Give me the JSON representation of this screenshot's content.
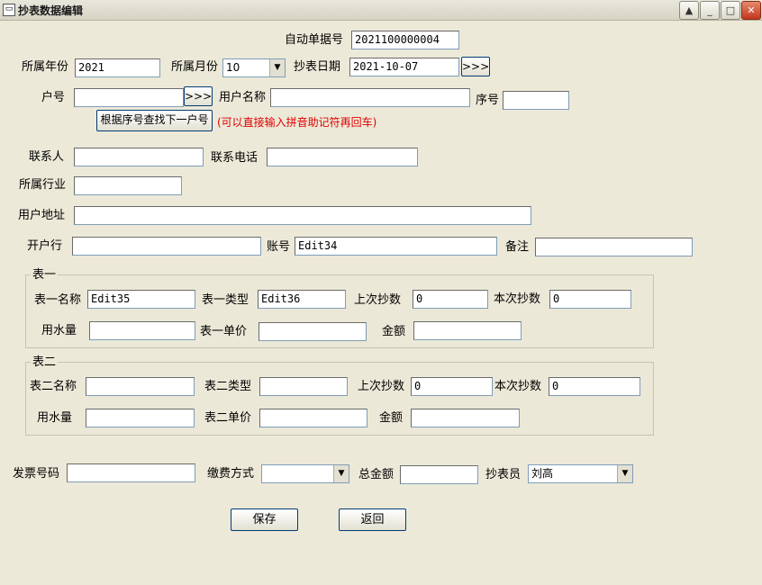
{
  "window": {
    "title": "抄表数据编辑",
    "min": "_",
    "max": "□",
    "close": "✕",
    "menu": "▲"
  },
  "form": {
    "bill_no": {
      "label": "自动单据号",
      "value": "2021100000004"
    },
    "year": {
      "label": "所属年份",
      "value": "2021"
    },
    "month": {
      "label": "所属月份",
      "value": "10"
    },
    "read_date": {
      "label": "抄表日期",
      "value": "2021-10-07",
      "button": ">>>"
    },
    "account_no": {
      "label": "户号",
      "value": "",
      "button": ">>>"
    },
    "user_name": {
      "label": "用户名称",
      "value": ""
    },
    "seq_no": {
      "label": "序号",
      "value": ""
    },
    "find_next": {
      "label": "根据序号查找下一户号"
    },
    "hint": "(可以直接输入拼音助记符再回车)",
    "contact": {
      "label": "联系人",
      "value": ""
    },
    "phone": {
      "label": "联系电话",
      "value": ""
    },
    "industry": {
      "label": "所属行业",
      "value": ""
    },
    "address": {
      "label": "用户地址",
      "value": ""
    },
    "bank": {
      "label": "开户行",
      "value": ""
    },
    "bank_account": {
      "label": "账号",
      "value": "Edit34"
    },
    "remark": {
      "label": "备注",
      "value": ""
    }
  },
  "meter1": {
    "title": "表一",
    "name": {
      "label": "表一名称",
      "value": "Edit35"
    },
    "type": {
      "label": "表一类型",
      "value": "Edit36"
    },
    "last": {
      "label": "上次抄数",
      "value": "0"
    },
    "current": {
      "label": "本次抄数",
      "value": "0"
    },
    "usage": {
      "label": "用水量",
      "value": ""
    },
    "price": {
      "label": "表一单价",
      "value": ""
    },
    "amount": {
      "label": "金额",
      "value": ""
    }
  },
  "meter2": {
    "title": "表二",
    "name": {
      "label": "表二名称",
      "value": ""
    },
    "type": {
      "label": "表二类型",
      "value": ""
    },
    "last": {
      "label": "上次抄数",
      "value": "0"
    },
    "current": {
      "label": "本次抄数",
      "value": "0"
    },
    "usage": {
      "label": "用水量",
      "value": ""
    },
    "price": {
      "label": "表二单价",
      "value": ""
    },
    "amount": {
      "label": "金额",
      "value": ""
    }
  },
  "footer": {
    "invoice": {
      "label": "发票号码",
      "value": ""
    },
    "payment": {
      "label": "缴费方式",
      "value": ""
    },
    "total": {
      "label": "总金额",
      "value": ""
    },
    "reader": {
      "label": "抄表员",
      "value": "刘高"
    },
    "save": "保存",
    "back": "返回"
  },
  "icons": {
    "dropdown": "chevron-down-icon",
    "app": "window-icon"
  }
}
